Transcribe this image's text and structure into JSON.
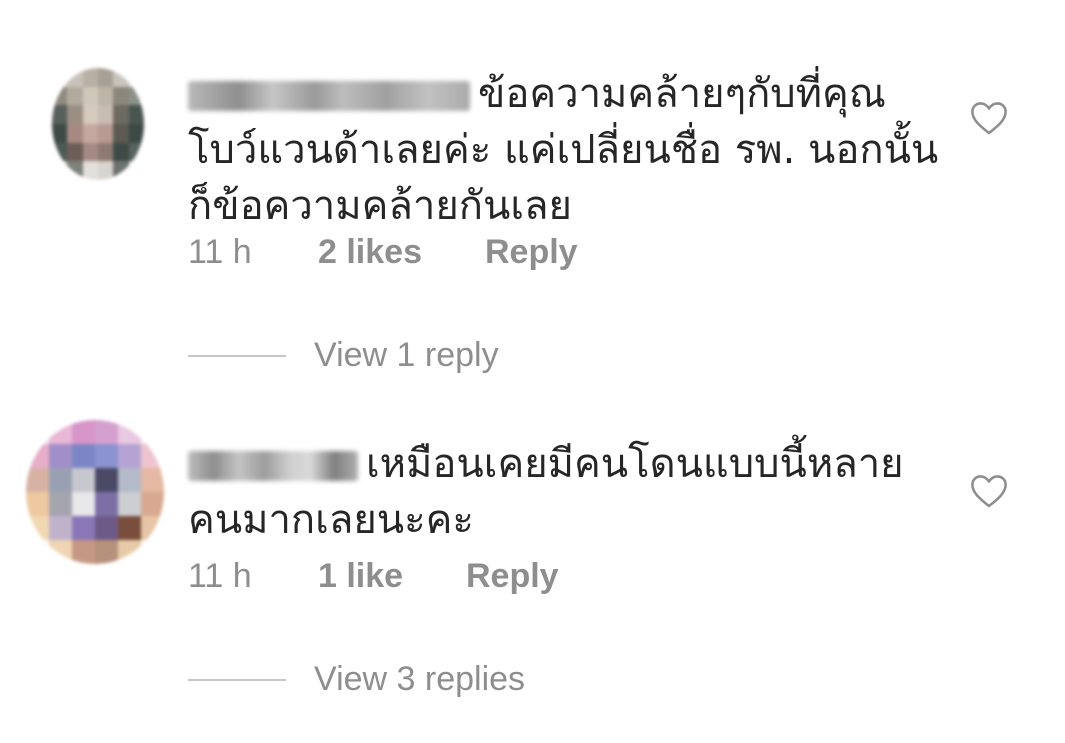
{
  "comments": [
    {
      "body_lines": [
        "ข้อความคล้ายๆกับที่คุณ",
        "โบว์แวนด้าเลยค่ะ แค่เปลี่ยนชื่อ รพ. นอกนั้น",
        "ก็ข้อความคล้ายกันเลย"
      ],
      "time": "11 h",
      "likes": "2 likes",
      "reply_label": "Reply",
      "view_replies": "View 1 reply"
    },
    {
      "body_lines": [
        "เหมือนเคยมีคนโดนแบบนี้หลาย",
        "คนมากเลยนะคะ"
      ],
      "time": "11 h",
      "likes": "1 like",
      "reply_label": "Reply",
      "view_replies": "View 3 replies"
    }
  ],
  "colors": {
    "text": "#262626",
    "secondary": "#8e8e8e",
    "divider": "#c7c7c7"
  },
  "icons": {
    "like": "heart-outline-icon",
    "avatar": "blurred-avatar"
  }
}
